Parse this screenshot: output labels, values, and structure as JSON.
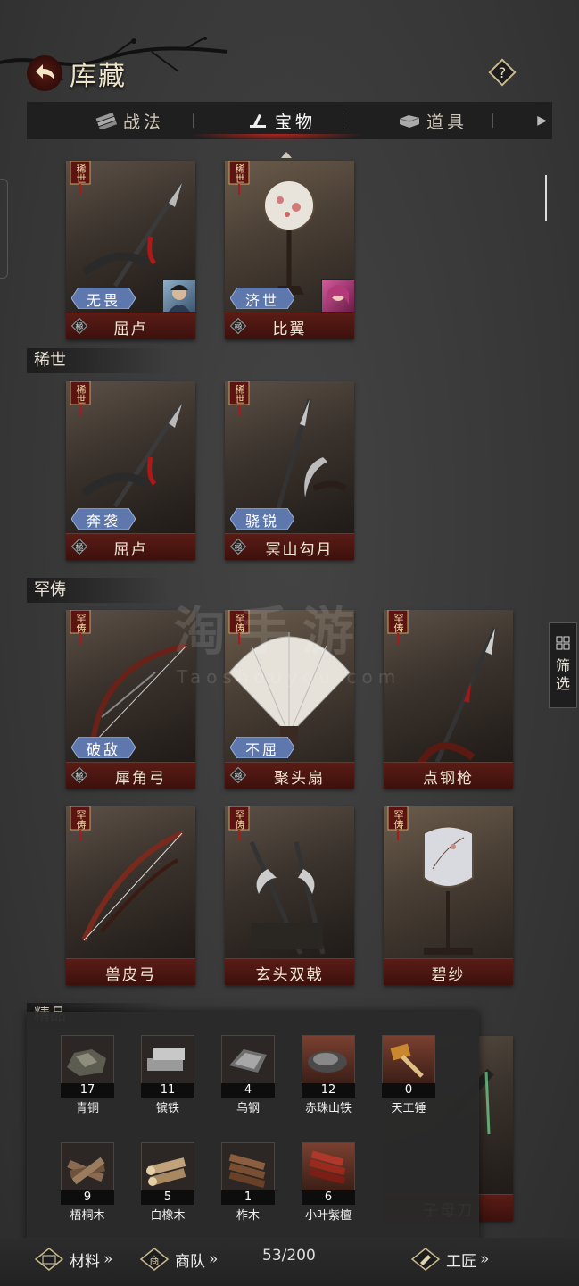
{
  "header": {
    "title": "库藏",
    "help_label": "?"
  },
  "tabs": [
    {
      "label": "战法",
      "icon": "scroll-bundle-icon",
      "active": false
    },
    {
      "label": "宝物",
      "icon": "treasure-icon",
      "active": true
    },
    {
      "label": "道具",
      "icon": "item-chest-icon",
      "active": false
    }
  ],
  "sections": {
    "xishi": "稀世",
    "hanchou": "罕俦",
    "jingpin": "精品"
  },
  "top_cards": [
    {
      "name": "屈卢",
      "rarity": "稀世",
      "skill": "无畏",
      "grade": "極",
      "portrait": "hero-portrait-male"
    },
    {
      "name": "比翼",
      "rarity": "稀世",
      "skill": "济世",
      "grade": "極",
      "portrait": "hero-portrait-female"
    }
  ],
  "xishi_cards": [
    {
      "name": "屈卢",
      "rarity": "稀世",
      "skill": "奔袭",
      "grade": "極"
    },
    {
      "name": "冥山勾月",
      "rarity": "稀世",
      "skill": "骁锐",
      "grade": "極"
    }
  ],
  "hanchou_cards": [
    {
      "name": "犀角弓",
      "rarity": "罕俦",
      "skill": "破敌",
      "grade": "極"
    },
    {
      "name": "聚头扇",
      "rarity": "罕俦",
      "skill": "不屈",
      "grade": "極"
    },
    {
      "name": "点钢枪",
      "rarity": "罕俦"
    },
    {
      "name": "兽皮弓",
      "rarity": "罕俦"
    },
    {
      "name": "玄头双戟",
      "rarity": "罕俦"
    },
    {
      "name": "碧纱",
      "rarity": "罕俦"
    }
  ],
  "jingpin_partial": {
    "name": "子母刀"
  },
  "materials": [
    {
      "name": "青铜",
      "count": "17",
      "icon": "bronze-ore-icon"
    },
    {
      "name": "镔铁",
      "count": "11",
      "icon": "iron-ingot-icon"
    },
    {
      "name": "乌钢",
      "count": "4",
      "icon": "black-steel-icon"
    },
    {
      "name": "赤珠山铁",
      "count": "12",
      "icon": "red-ore-icon"
    },
    {
      "name": "天工锤",
      "count": "0",
      "icon": "hammer-icon"
    },
    {
      "name": "梧桐木",
      "count": "9",
      "icon": "wood-logs-icon"
    },
    {
      "name": "白橡木",
      "count": "5",
      "icon": "oak-logs-icon"
    },
    {
      "name": "柞木",
      "count": "1",
      "icon": "planks-icon"
    },
    {
      "name": "小叶紫檀",
      "count": "6",
      "icon": "red-sandalwood-icon"
    }
  ],
  "filter_label": "筛选",
  "bottom": {
    "materials_label": "材料",
    "caravan_label": "商队",
    "capacity": "53/200",
    "craftsman_label": "工匠",
    "chevrons": "»"
  },
  "watermark": {
    "main": "淘手游",
    "sub": "Taoshouyou.com"
  },
  "colors": {
    "accent_red": "#b3261e",
    "name_bar": "#4a1510",
    "skill_badge": "#6c86b8"
  }
}
